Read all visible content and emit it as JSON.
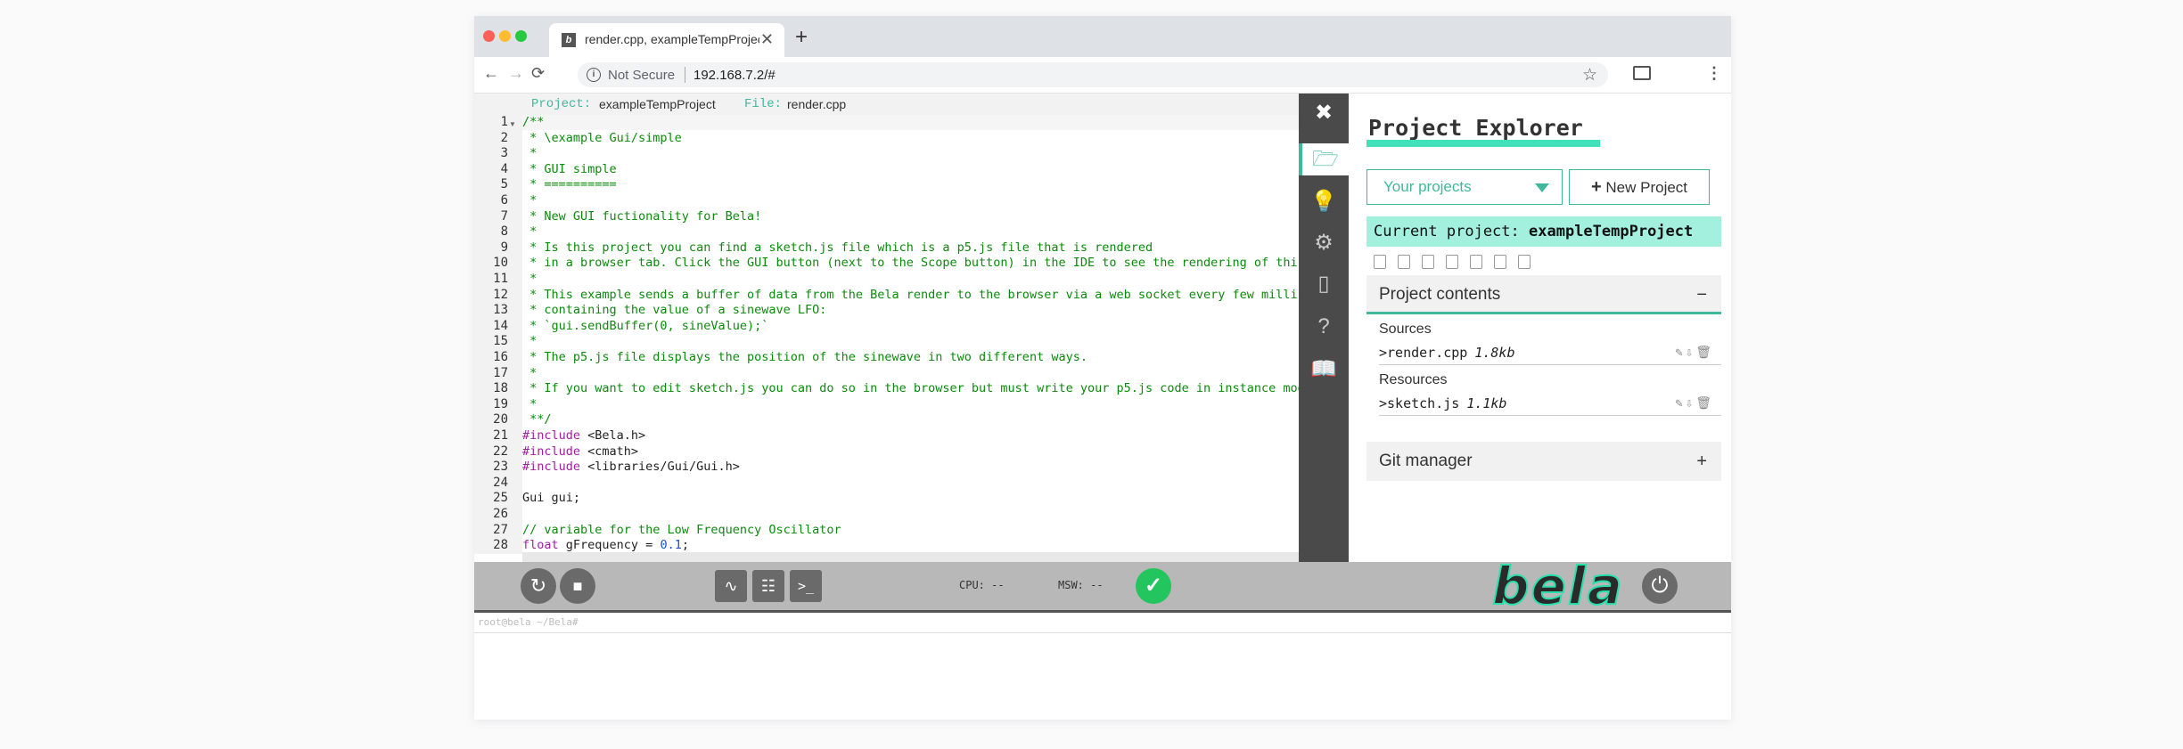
{
  "browser": {
    "tab_title": "render.cpp, exampleTempProject",
    "favicon_letter": "b",
    "close_glyph": "✕",
    "new_tab_glyph": "+",
    "nav": {
      "back": "←",
      "forward": "→",
      "reload": "⟳"
    },
    "address": {
      "security_label": "Not Secure",
      "url": "192.168.7.2/#",
      "info_glyph": "i",
      "star_glyph": "☆"
    },
    "menu_glyph": "⋮"
  },
  "editor": {
    "project_label": "Project:",
    "project_name": "exampleTempProject",
    "file_label": "File:",
    "file_name": "render.cpp",
    "lines": [
      "/**",
      " * \\example Gui/simple",
      " *",
      " * GUI simple",
      " * ==========",
      " *",
      " * New GUI fuctionality for Bela!",
      " *",
      " * Is this project you can find a sketch.js file which is a p5.js file that is rendered",
      " * in a browser tab. Click the GUI button (next to the Scope button) in the IDE to see the rendering of this",
      " *",
      " * This example sends a buffer of data from the Bela render to the browser via a web socket every few millise",
      " * containing the value of a sinewave LFO:",
      " * `gui.sendBuffer(0, sineValue);`",
      " *",
      " * The p5.js file displays the position of the sinewave in two different ways.",
      " *",
      " * If you want to edit sketch.js you can do so in the browser but must write your p5.js code in instance mode",
      " *",
      " **/",
      "#include <Bela.h>",
      "#include <cmath>",
      "#include <libraries/Gui/Gui.h>",
      "",
      "Gui gui;",
      "",
      "// variable for the Low Frequency Oscillator",
      "float gFrequency = 0.1;"
    ]
  },
  "iconbar": {
    "close": "✖",
    "items": [
      "folder-icon",
      "lightbulb-icon",
      "gear-icon",
      "chip-icon",
      "help-icon",
      "book-icon"
    ],
    "glyphs": [
      "🗁",
      "💡",
      "⚙",
      "▯",
      "?",
      "📖"
    ]
  },
  "explorer": {
    "title": "Project Explorer",
    "your_projects": "Your projects",
    "new_project": "New Project",
    "new_project_glyph": "+",
    "current_label": "Current project:",
    "current_name": "exampleTempProject",
    "contents_title": "Project contents",
    "contents_toggle": "−",
    "sources_label": "Sources",
    "sources": [
      {
        "name": "render.cpp",
        "size": "1.8kb"
      }
    ],
    "resources_label": "Resources",
    "resources": [
      {
        "name": "sketch.js",
        "size": "1.1kb"
      }
    ],
    "file_prefix": ">",
    "file_actions": "✎⇩🗑",
    "git_title": "Git manager",
    "git_toggle": "+"
  },
  "toolbar": {
    "run_glyph": "↻",
    "stop_glyph": "■",
    "scope_glyph": "∿",
    "settings_glyph": "☷",
    "console_glyph": ">_",
    "cpu_label": "CPU: --",
    "msw_label": "MSW: --",
    "status_glyph": "✓",
    "logo_text": "bela",
    "power_glyph": "⏻"
  },
  "console": {
    "prompt": "root@bela ~/Bela#"
  },
  "colors": {
    "accent": "#41b89b",
    "highlight": "#a3f0df",
    "toolbar": "#b8b8b8",
    "iconbar": "#4a4a4a"
  }
}
